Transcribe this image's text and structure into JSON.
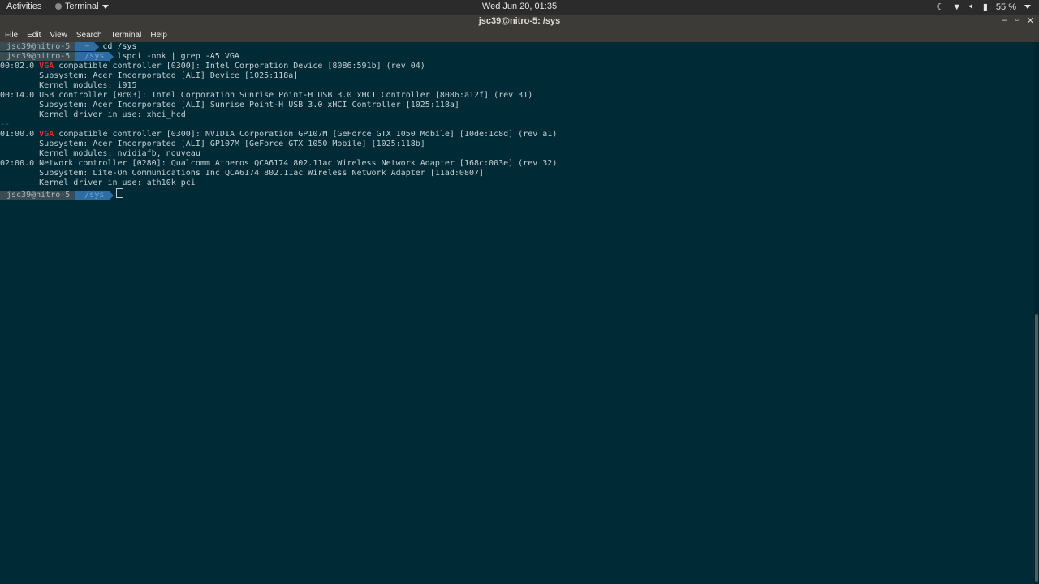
{
  "topbar": {
    "activities": "Activities",
    "app_menu": "Terminal",
    "clock": "Wed Jun 20, 01:35",
    "battery": "55 %"
  },
  "window": {
    "title": "jsc39@nitro-5: /sys",
    "controls": [
      "–",
      "▫",
      "✕"
    ]
  },
  "menubar": [
    "File",
    "Edit",
    "View",
    "Search",
    "Terminal",
    "Help"
  ],
  "terminal": {
    "prompt_user": "jsc39@nitro-5",
    "prompts": [
      {
        "dir": "~",
        "command": "cd /sys"
      },
      {
        "dir": "/sys",
        "command": "lspci -nnk | grep -A5 VGA"
      },
      {
        "dir": "/sys",
        "command": ""
      }
    ],
    "output": [
      {
        "pre": "00:02.0 ",
        "hl": "VGA",
        "post": " compatible controller [0300]: Intel Corporation Device [8086:591b] (rev 04)"
      },
      {
        "pre": "",
        "hl": "",
        "post": "        Subsystem: Acer Incorporated [ALI] Device [1025:118a]"
      },
      {
        "pre": "",
        "hl": "",
        "post": "        Kernel modules: i915"
      },
      {
        "pre": "",
        "hl": "",
        "post": "00:14.0 USB controller [0c03]: Intel Corporation Sunrise Point-H USB 3.0 xHCI Controller [8086:a12f] (rev 31)"
      },
      {
        "pre": "",
        "hl": "",
        "post": "        Subsystem: Acer Incorporated [ALI] Sunrise Point-H USB 3.0 xHCI Controller [1025:118a]"
      },
      {
        "pre": "",
        "hl": "",
        "post": "        Kernel driver in use: xhci_hcd"
      },
      {
        "pre": "",
        "hl": "",
        "post": "--",
        "sep": true
      },
      {
        "pre": "01:00.0 ",
        "hl": "VGA",
        "post": " compatible controller [0300]: NVIDIA Corporation GP107M [GeForce GTX 1050 Mobile] [10de:1c8d] (rev a1)"
      },
      {
        "pre": "",
        "hl": "",
        "post": "        Subsystem: Acer Incorporated [ALI] GP107M [GeForce GTX 1050 Mobile] [1025:118b]"
      },
      {
        "pre": "",
        "hl": "",
        "post": "        Kernel modules: nvidiafb, nouveau"
      },
      {
        "pre": "",
        "hl": "",
        "post": "02:00.0 Network controller [0280]: Qualcomm Atheros QCA6174 802.11ac Wireless Network Adapter [168c:003e] (rev 32)"
      },
      {
        "pre": "",
        "hl": "",
        "post": "        Subsystem: Lite-On Communications Inc QCA6174 802.11ac Wireless Network Adapter [11ad:0807]"
      },
      {
        "pre": "",
        "hl": "",
        "post": "        Kernel driver in use: ath10k_pci"
      }
    ]
  },
  "colors": {
    "background": "#002b36",
    "highlight": "#dc322f",
    "prompt_dir_bg": "#2e6da4"
  }
}
